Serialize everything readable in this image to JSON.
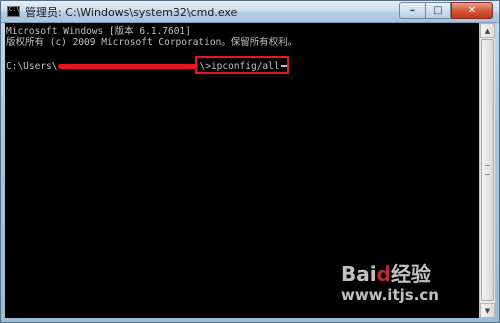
{
  "window": {
    "title": "管理员: C:\\Windows\\system32\\cmd.exe",
    "icon": "cmd-icon"
  },
  "caption_buttons": {
    "minimize": "–",
    "maximize": "□",
    "close": "✕"
  },
  "console": {
    "lines": [
      "Microsoft Windows [版本 6.1.7601]",
      "版权所有 (c) 2009 Microsoft Corporation。保留所有权利。"
    ],
    "prompt_prefix": "C:\\Users\\",
    "prompt_suffix": "\\>",
    "command": "ipconfig/all",
    "redaction_color": "#e8141f",
    "highlight_color": "#e11b1b"
  },
  "scrollbar": {
    "up": "▲",
    "down": "▼"
  },
  "watermark": {
    "logo_part1": "Bai",
    "logo_part2": "d",
    "logo_part3": "经验",
    "url": "www.itjs.cn"
  }
}
